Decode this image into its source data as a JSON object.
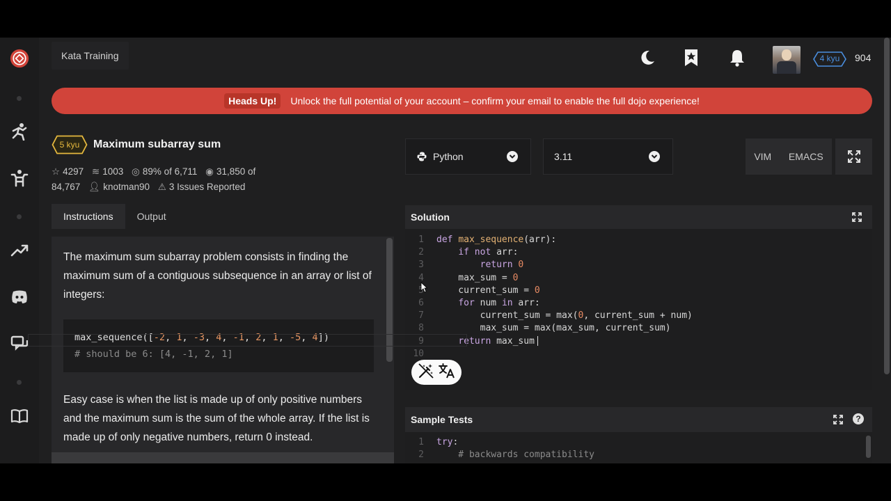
{
  "header": {
    "breadcrumb": "Kata Training",
    "rank_badge": "4 kyu",
    "honor": "904"
  },
  "banner": {
    "strong": "Heads Up!",
    "message": "Unlock the full potential of your account – confirm your email to enable the full dojo experience!"
  },
  "kata": {
    "rank": "5 kyu",
    "title": "Maximum subarray sum",
    "stars": "4297",
    "collections": "1003",
    "satisfaction": "89% of 6,711",
    "completed_a": "31,850 of",
    "completed_b": "84,767",
    "author": "knotman90",
    "issues": "3 Issues Reported"
  },
  "tabs": [
    {
      "label": "Instructions"
    },
    {
      "label": "Output"
    }
  ],
  "instructions": {
    "p1": "The maximum sum subarray problem consists in finding the maximum sum of a contiguous subsequence in an array or list of integers:",
    "code_fn": "max_sequence([",
    "code_args": [
      "-2",
      "1",
      "-3",
      "4",
      "-1",
      "2",
      "1",
      "-5",
      "4"
    ],
    "code_close": "])",
    "code_comment": "# should be 6: [4, -1, 2, 1]",
    "p2": "Easy case is when the list is made up of only positive numbers and the maximum sum is the sum of the whole array. If the list is made up of only negative numbers, return 0 instead."
  },
  "language": {
    "selected": "Python"
  },
  "version": {
    "selected": "3.11"
  },
  "editor_modes": [
    "VIM",
    "EMACS"
  ],
  "solution": {
    "title": "Solution",
    "lines": [
      {
        "n": "1",
        "code": "def max_sequence(arr):"
      },
      {
        "n": "2",
        "code": "    if not arr:"
      },
      {
        "n": "3",
        "code": "        return 0"
      },
      {
        "n": "4",
        "code": "    max_sum = 0"
      },
      {
        "n": "5",
        "code": "    current_sum = 0"
      },
      {
        "n": "6",
        "code": "    for num in arr:"
      },
      {
        "n": "7",
        "code": "        current_sum = max(0, current_sum + num)"
      },
      {
        "n": "8",
        "code": "        max_sum = max(max_sum, current_sum)"
      },
      {
        "n": "9",
        "code": "    return max_sum"
      },
      {
        "n": "10",
        "code": ""
      }
    ]
  },
  "sample_tests": {
    "title": "Sample Tests",
    "lines": [
      {
        "n": "1",
        "code": "try:"
      },
      {
        "n": "2",
        "code": "    # backwards compatibility"
      }
    ]
  },
  "colors": {
    "banner": "#d1443a",
    "kyu5": "#e6b93e",
    "kyu4": "#4a8fe0",
    "logo": "#d1443a"
  },
  "icons": {
    "theme": "moon-icon",
    "bookmark": "bookmark-star-icon",
    "notifications": "bell-icon"
  }
}
